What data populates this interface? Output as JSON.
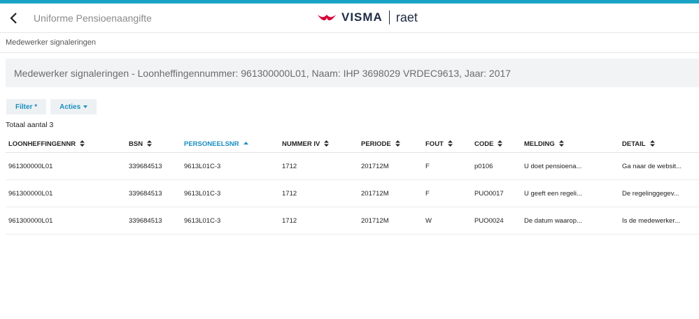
{
  "header": {
    "title": "Uniforme Pensioenaangifte",
    "brand_primary": "VISMA",
    "brand_secondary": "raet"
  },
  "breadcrumb": "Medewerker signaleringen",
  "banner": "Medewerker signaleringen - Loonheffingennummer: 961300000L01, Naam: IHP 3698029 VRDEC9613, Jaar: 2017",
  "toolbar": {
    "filter_label": "Filter *",
    "actions_label": "Acties"
  },
  "total_label": "Totaal aantal 3",
  "table": {
    "columns": [
      "LOONHEFFINGENNR",
      "BSN",
      "PERSONEELSNR",
      "NUMMER IV",
      "PERIODE",
      "FOUT",
      "CODE",
      "MELDING",
      "DETAIL"
    ],
    "sorted_column": "PERSONEELSNR",
    "rows": [
      [
        "961300000L01",
        "339684513",
        "9613L01C-3",
        "1712",
        "201712M",
        "F",
        "p0106",
        "U doet pensioena...",
        "Ga naar de websit..."
      ],
      [
        "961300000L01",
        "339684513",
        "9613L01C-3",
        "1712",
        "201712M",
        "F",
        "PUO0017",
        "U geeft een regeli...",
        "De regelinggegev..."
      ],
      [
        "961300000L01",
        "339684513",
        "9613L01C-3",
        "1712",
        "201712M",
        "W",
        "PUO0024",
        "De datum waarop...",
        "Is de medewerker..."
      ]
    ]
  },
  "colors": {
    "accent": "#1ba3c6",
    "link": "#1a8ec0",
    "brand_red": "#d6003a",
    "brand_navy": "#1f2a44"
  },
  "icons": {
    "back": "chevron-left-icon",
    "logo": "visma-logo-icon",
    "sort": "sort-both-icon",
    "sort_asc": "sort-asc-icon",
    "dropdown": "caret-down-icon"
  }
}
